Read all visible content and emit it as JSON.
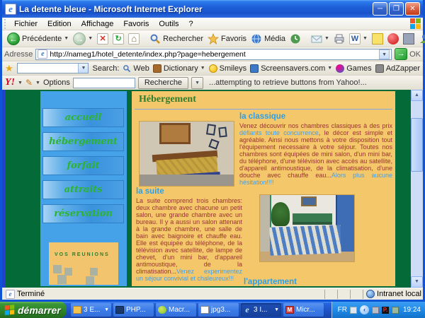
{
  "window": {
    "title": "La detente bleue - Microsoft Internet Explorer",
    "menu": {
      "items": [
        "Fichier",
        "Edition",
        "Affichage",
        "Favoris",
        "Outils",
        "?"
      ]
    },
    "toolbar": {
      "back_label": "Précédente",
      "search_label": "Rechercher",
      "favorites_label": "Favoris",
      "media_label": "Média"
    },
    "address": {
      "label": "Adresse",
      "url": "http://nameg1/hotel_detente/index.php?page=hebergement",
      "go_label": "OK"
    },
    "searchbar": {
      "label": "Search:",
      "web": "Web",
      "dictionary": "Dictionary",
      "smileys": "Smileys",
      "screensavers": "Screensavers.com",
      "games": "Games",
      "adzapper": "AdZapper"
    },
    "yahoobar": {
      "logo": "Y!",
      "options_label": "Options",
      "button_label": "Recherche",
      "status": "...attempting to retrieve buttons from Yahoo!..."
    }
  },
  "page": {
    "header": "Hébergement",
    "nav": [
      "accueil",
      "hébergement",
      "forfait",
      "attraits",
      "réservation"
    ],
    "reunions_label": "VOS REUNIONS",
    "classique": {
      "title": "la classique",
      "p1": "Venez découvrir nos chambres classiques à des prix ",
      "link": "défiants toute concurrence",
      "p2": ", le décor est simple et agréable. Ainsi nous mettons à votre disposition tout l'équipement necessaire à votre séjour. Toutes nos chambres sont équipées de mini salon, d'un mini bar, du téléphone, d'une télévision avec accès au satellite, d'appareil antimoustique, de la climatisation, d'une douche avec chauffe eau...",
      "tail": "Alors plus aucune hésitation!!!!"
    },
    "suite": {
      "title": "la suite",
      "p1": "La suite comprend trois chambres: deux chambre avec chacune un petit salon, une grande chambre avec un bureau. Il y a aussi un salon attenant à la grande chambre, une salle de bain avec baignoire et chauffe eau. Elle est équipée du téléphone, de la télévision avec satellite, de lampe de chevet, d'un mini bar, d'appareil antimoustique, de la climatisation...",
      "tail": "Venez experimentez un séjour convivial et chaleureux!!!"
    },
    "appartement": {
      "title": "l'appartement"
    }
  },
  "statusbar": {
    "status": "Terminé",
    "zone": "Intranet local"
  },
  "taskbar": {
    "start_label": "démarrer",
    "items": [
      "3 E...",
      "PHP...",
      "Macr...",
      "jpg3...",
      "3 I...",
      "Micr..."
    ],
    "tray": {
      "lang": "FR",
      "time": "19:24"
    }
  },
  "icons": {
    "ie_e": "e",
    "minimize": "─",
    "maximize": "❐",
    "close": "✕",
    "back": "←",
    "forward": "→",
    "stop": "✕",
    "refresh": "↻",
    "home": "⌂",
    "dropdown": "▼",
    "go": "→",
    "star": "★",
    "pencil": "✎",
    "word": "W",
    "scroll_up": "▲",
    "scroll_down": "▼",
    "chevron_left": "‹",
    "m": "M",
    "p": "P."
  }
}
